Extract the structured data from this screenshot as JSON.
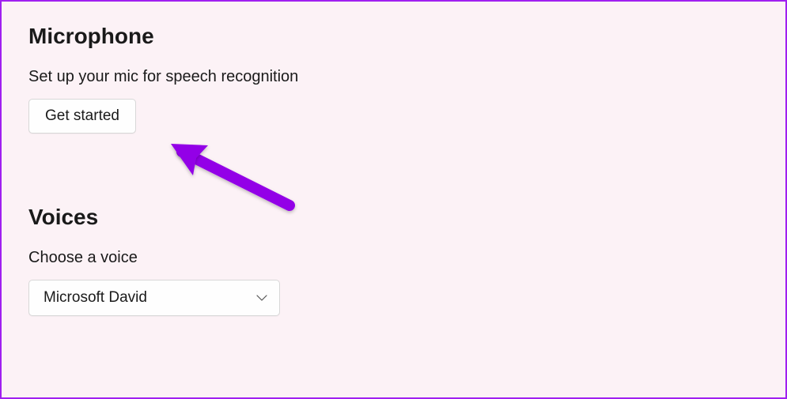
{
  "microphone": {
    "heading": "Microphone",
    "description": "Set up your mic for speech recognition",
    "button_label": "Get started"
  },
  "voices": {
    "heading": "Voices",
    "label": "Choose a voice",
    "selected": "Microsoft David"
  },
  "colors": {
    "accent": "#a020f0",
    "background": "#fcf2f6"
  }
}
